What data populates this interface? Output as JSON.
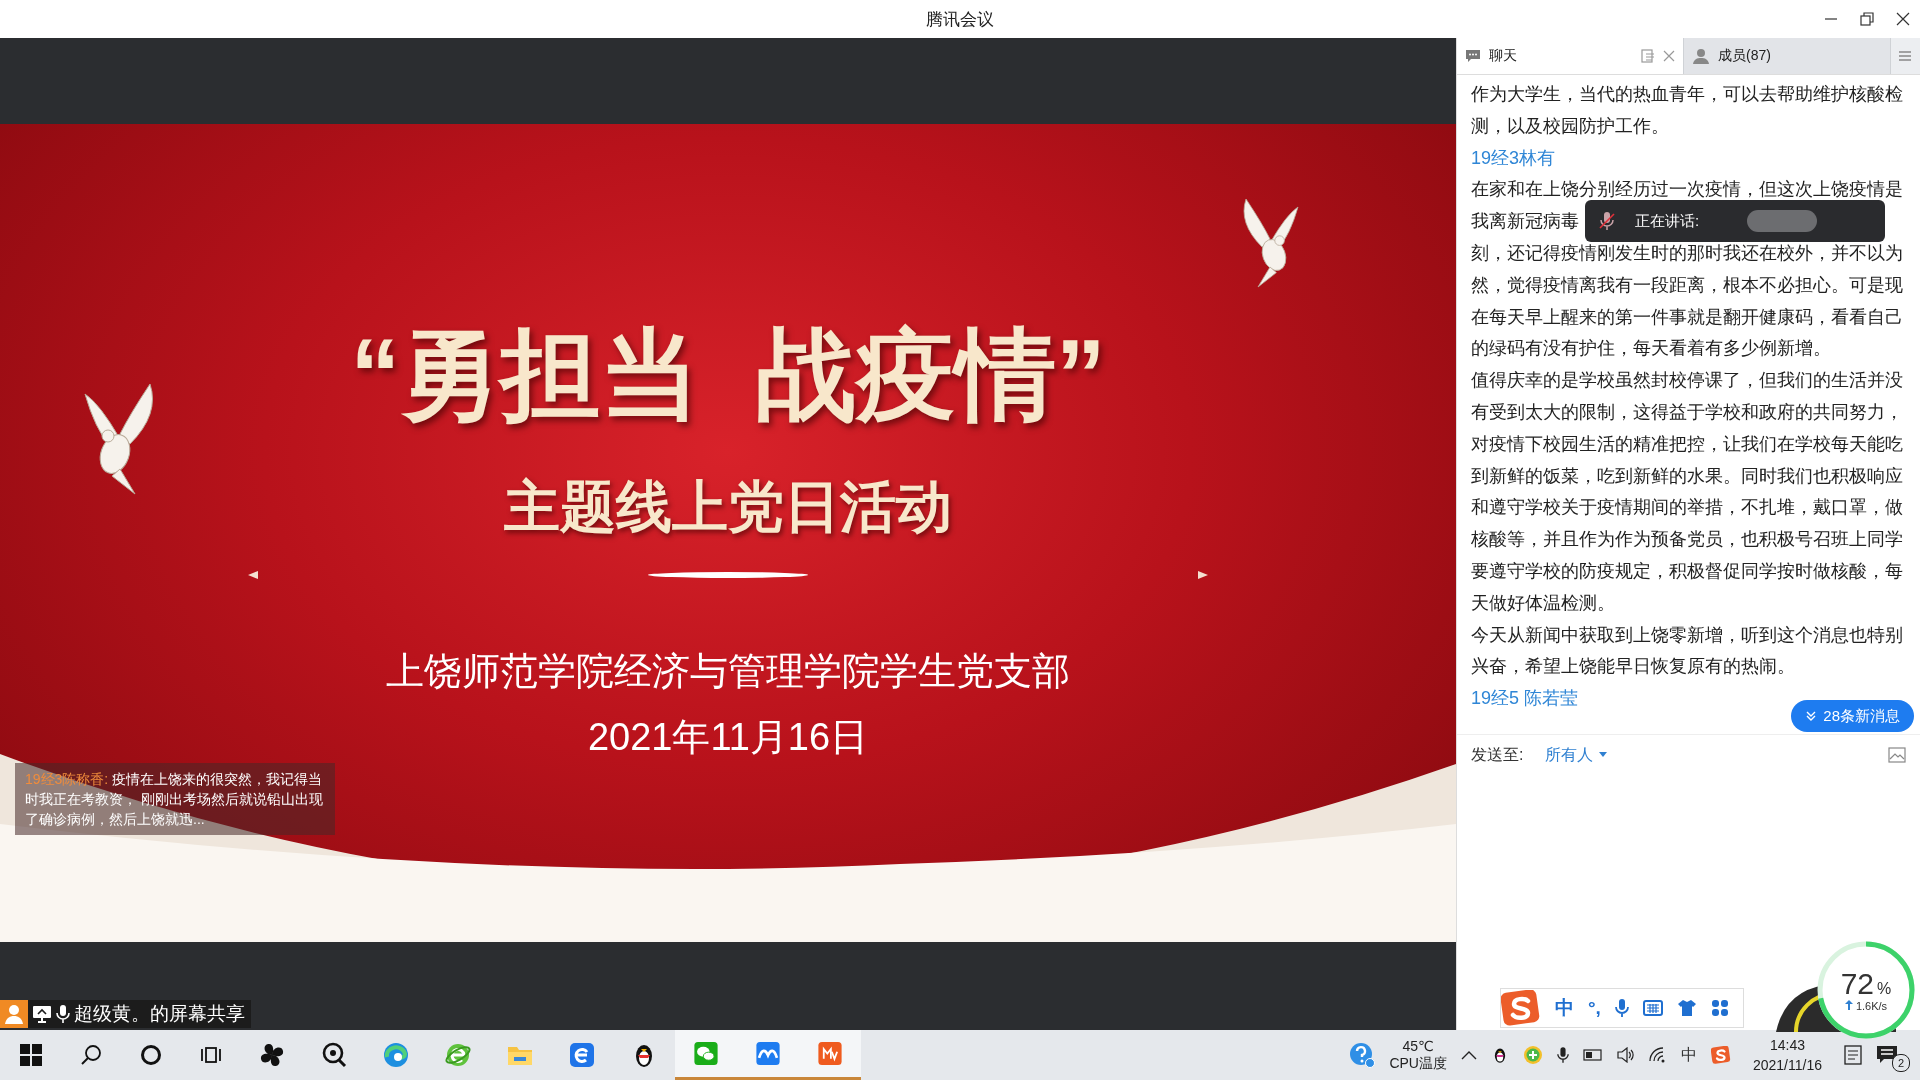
{
  "window": {
    "title": "腾讯会议"
  },
  "slide": {
    "title": "“勇担当  战疫情”",
    "subtitle": "主题线上党日活动",
    "organization": "上饶师范学院经济与管理学院学生党支部",
    "date": "2021年11月16日"
  },
  "chat_bubble": {
    "sender": "19经3陈称香:",
    "text": "疫情在上饶来的很突然，我记得当时我正在考教资， 刚刚出考场然后就说铅山出现了确诊病例，然后上饶就迅..."
  },
  "screen_share_label": "超级黄。的屏幕共享",
  "chat_panel": {
    "tabs": [
      {
        "label": "聊天",
        "selected": true
      },
      {
        "label": "成员(87)",
        "selected": false
      }
    ],
    "messages": [
      {
        "kind": "text",
        "lines": [
          "作为大学生，当代的热血青年，可以去帮助维护核酸检",
          "测，以及校园防护工作。"
        ]
      },
      {
        "kind": "sender",
        "text": "19经3林有"
      },
      {
        "kind": "text",
        "lines": [
          "在家和在上饶分别经历过一次疫情，但这次上饶疫情是",
          "我离新冠病毒",
          "刻，还记得疫情刚发生时的那时我还在校外，并不以为",
          "然，觉得疫情离我有一段距离，根本不必担心。可是现",
          "在每天早上醒来的第一件事就是翻开健康码，看看自己",
          "的绿码有没有护住，每天看着有多少例新增。"
        ]
      },
      {
        "kind": "text",
        "lines": [
          "值得庆幸的是学校虽然封校停课了，但我们的生活并没",
          "有受到太大的限制，这得益于学校和政府的共同努力，",
          "对疫情下校园生活的精准把控，让我们在学校每天能吃",
          "到新鲜的饭菜，吃到新鲜的水果。同时我们也积极响应",
          "和遵守学校关于疫情期间的举措，不扎堆，戴口罩，做",
          "核酸等，并且作为作为预备党员，也积极号召班上同学",
          "要遵守学校的防疫规定，积极督促同学按时做核酸，每",
          "天做好体温检测。"
        ]
      },
      {
        "kind": "text",
        "lines": [
          "今天从新闻中获取到上饶零新增，听到这个消息也特别",
          "兴奋，希望上饶能早日恢复原有的热闹。"
        ]
      },
      {
        "kind": "sender",
        "text": "19经5 陈若莹"
      }
    ],
    "speaking_popup": {
      "label": "正在讲话:"
    },
    "new_messages_button": "28条新消息",
    "send_to": {
      "label": "发送至:",
      "value": "所有人"
    }
  },
  "ime_toolbar": {
    "mode": "中",
    "punctuation": "°,"
  },
  "net_widget": {
    "value": "72",
    "unit": "%",
    "speed": "1.6K/s",
    "level": 0.72
  },
  "taskbar": {
    "apps": [
      {
        "kind": "pinwheel",
        "open": false
      },
      {
        "kind": "magnifier",
        "open": false
      },
      {
        "kind": "edge",
        "open": false
      },
      {
        "kind": "ie",
        "open": false
      },
      {
        "kind": "folder",
        "open": false
      },
      {
        "kind": "blue-e",
        "open": false
      },
      {
        "kind": "penguin",
        "open": false
      },
      {
        "kind": "wechat",
        "open": true
      },
      {
        "kind": "meeting",
        "open": true
      },
      {
        "kind": "tv",
        "open": true
      }
    ],
    "cpu_temp": "45℃",
    "cpu_label": "CPU温度",
    "tray_ime": "中",
    "time": "14:43",
    "date": "2021/11/16",
    "notification_count": "2"
  }
}
